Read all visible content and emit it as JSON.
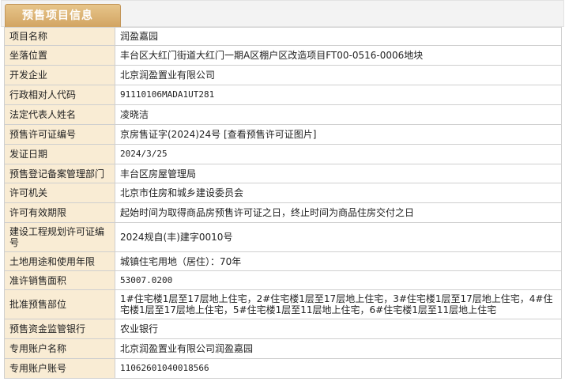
{
  "header": {
    "tab_title": "预售项目信息"
  },
  "rows": [
    {
      "label": "项目名称",
      "value": "润盈嘉园"
    },
    {
      "label": "坐落位置",
      "value": "丰台区大红门街道大红门一期A区棚户区改造项目FT00-0516-0006地块"
    },
    {
      "label": "开发企业",
      "value": "北京润盈置业有限公司"
    },
    {
      "label": "行政相对人代码",
      "value": "91110106MADA1UT281"
    },
    {
      "label": "法定代表人姓名",
      "value": "凌晓洁"
    },
    {
      "label": "预售许可证编号",
      "value": "京房售证字(2024)24号",
      "link": "[查看预售许可证图片]"
    },
    {
      "label": "发证日期",
      "value": "2024/3/25"
    },
    {
      "label": "预售登记备案管理部门",
      "value": "丰台区房屋管理局"
    },
    {
      "label": "许可机关",
      "value": "北京市住房和城乡建设委员会"
    },
    {
      "label": "许可有效期限",
      "value": "起始时间为取得商品房预售许可证之日，终止时间为商品住房交付之日"
    },
    {
      "label": "建设工程规划许可证编号",
      "value": "2024规自(丰)建字0010号"
    },
    {
      "label": "土地用途和使用年限",
      "value": "城镇住宅用地（居住）：70年"
    },
    {
      "label": "准许销售面积",
      "value": "53007.0200"
    },
    {
      "label": "批准预售部位",
      "value": "1#住宅楼1层至17层地上住宅，2#住宅楼1层至17层地上住宅，3#住宅楼1层至17层地上住宅，4#住宅楼1层至17层地上住宅，5#住宅楼1层至11层地上住宅，6#住宅楼1层至11层地上住宅"
    },
    {
      "label": "预售资金监管银行",
      "value": "农业银行"
    },
    {
      "label": "专用账户名称",
      "value": "北京润盈置业有限公司润盈嘉园"
    },
    {
      "label": "专用账户账号",
      "value": "11062601040018566"
    }
  ]
}
